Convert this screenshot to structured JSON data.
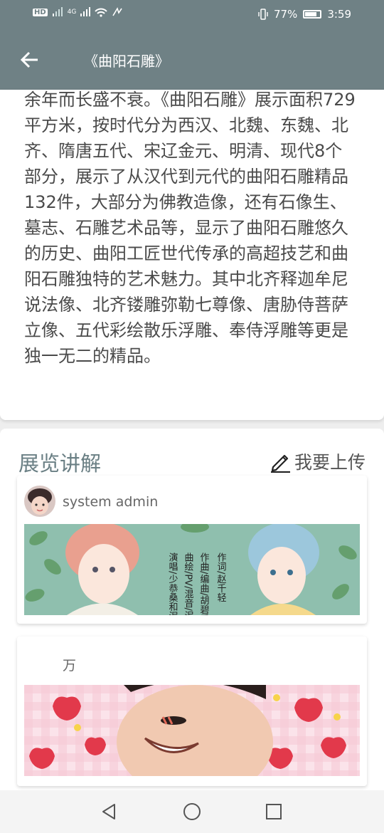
{
  "status": {
    "left_icons": [
      "hd-icon",
      "signal-icon",
      "signal-4g-icon",
      "wifi-icon",
      "nfc-icon"
    ],
    "hd": "HD",
    "net": "4G",
    "battery_pct": "77%",
    "battery_level": 0.77,
    "time": "3:59"
  },
  "appbar": {
    "title": "《曲阳石雕》"
  },
  "intro": {
    "text": "余年而长盛不衰。《曲阳石雕》展示面积729平方米，按时代分为西汉、北魏、东魏、北齐、隋唐五代、宋辽金元、明清、现代8个部分，展示了从汉代到元代的曲阳石雕精品132件，大部分为佛教造像，还有石像生、墓志、石雕艺术品等，显示了曲阳石雕悠久的历史、曲阳工匠世代传承的高超技艺和曲阳石雕独特的艺术魅力。其中北齐释迦牟尼说法像、北齐镂雕弥勒七尊像、唐胁侍菩萨立像、五代彩绘散乐浮雕、奉侍浮雕等更是独一无二的精品。"
  },
  "explain": {
    "title": "展览讲解",
    "upload_label": "我要上传",
    "posts": [
      {
        "author": "system admin",
        "image_text_1": "作词/赵千轻",
        "image_text_2": "作曲/编曲/胡碧乔",
        "image_text_3": "曲绘/PV/混音/泥",
        "image_text_4": "演唱/少恭桑和泥"
      },
      {
        "author": "万"
      }
    ]
  },
  "colors": {
    "appbar": "#6f8185",
    "accent_title": "#6a7f84",
    "text": "#4a4a4a"
  }
}
